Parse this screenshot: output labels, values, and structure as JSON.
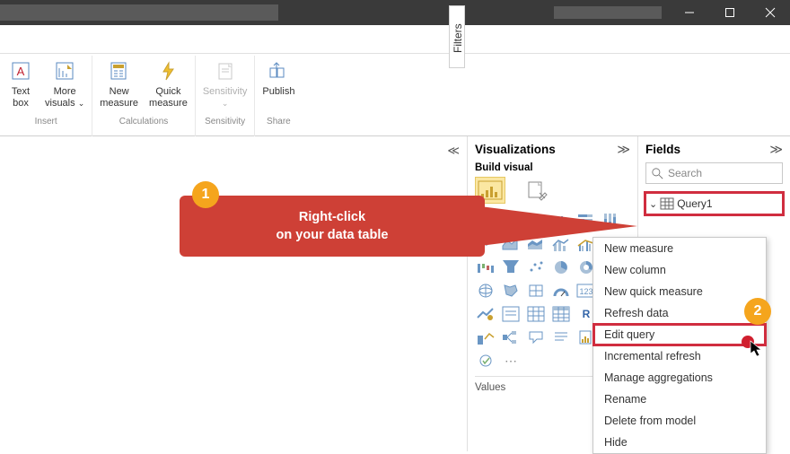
{
  "titlebar": {
    "min_label": "Minimize",
    "max_label": "Restore",
    "close_label": "Close"
  },
  "ribbon": {
    "insert": {
      "textbox": "Text\nbox",
      "more_visuals": "More\nvisuals",
      "label": "Insert"
    },
    "calculations": {
      "new_measure": "New\nmeasure",
      "quick_measure": "Quick\nmeasure",
      "label": "Calculations"
    },
    "sensitivity": {
      "button": "Sensitivity",
      "label": "Sensitivity"
    },
    "share": {
      "publish": "Publish",
      "label": "Share"
    }
  },
  "filters_label": "Filters",
  "viz": {
    "title": "Visualizations",
    "build": "Build visual",
    "values": "Values"
  },
  "fields": {
    "title": "Fields",
    "search_placeholder": "Search",
    "query": "Query1"
  },
  "context_menu": {
    "items": [
      "New measure",
      "New column",
      "New quick measure",
      "Refresh data",
      "Edit query",
      "Incremental refresh",
      "Manage aggregations",
      "Rename",
      "Delete from model",
      "Hide"
    ],
    "highlight_index": 4
  },
  "callout": {
    "line1": "Right-click",
    "line2": "on your data table",
    "badge1": "1",
    "badge2": "2"
  }
}
